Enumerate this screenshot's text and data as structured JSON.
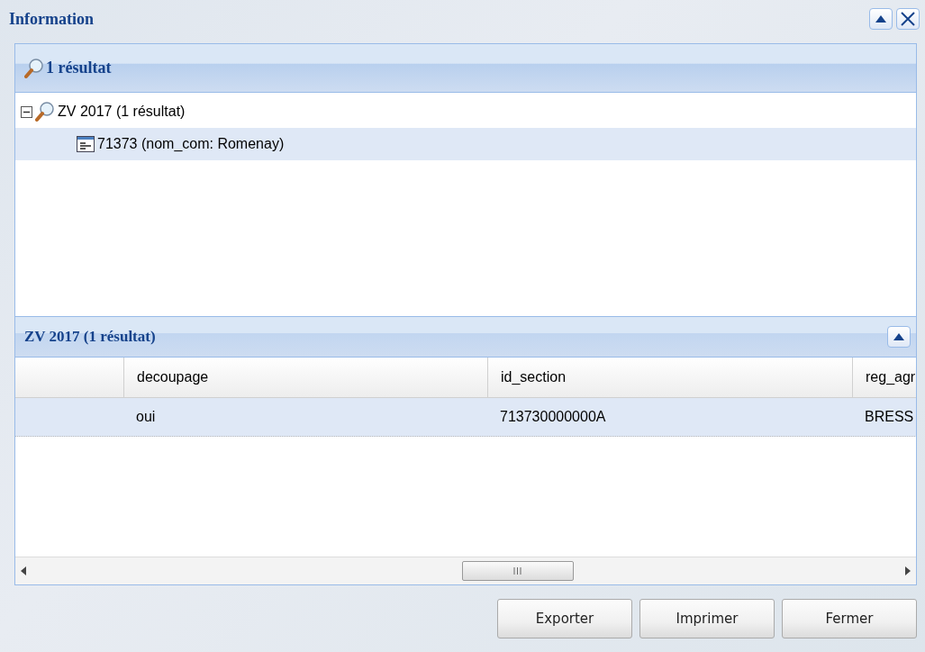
{
  "window": {
    "title": "Information"
  },
  "results_panel": {
    "title": "1 résultat",
    "tree": [
      {
        "label": "ZV 2017 (1 résultat)",
        "expanded": true,
        "selected": false,
        "children": [
          {
            "label": "71373 (nom_com: Romenay)",
            "selected": true
          }
        ]
      }
    ]
  },
  "grid_panel": {
    "title": "ZV 2017 (1 résultat)",
    "columns": [
      "decoupage",
      "id_section",
      "reg_agr"
    ],
    "rows": [
      {
        "cells": [
          "oui",
          "713730000000A",
          "BRESS"
        ],
        "selected": true
      }
    ]
  },
  "buttons": [
    "Exporter",
    "Imprimer",
    "Fermer"
  ]
}
